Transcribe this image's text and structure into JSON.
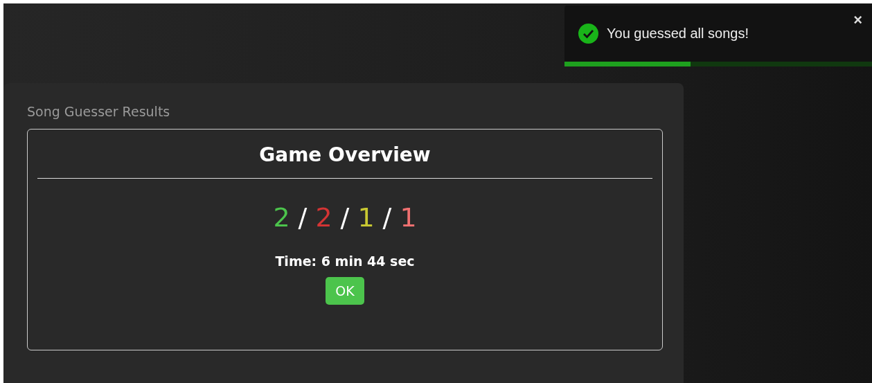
{
  "toast": {
    "message": "You guessed all songs!",
    "close": "×",
    "level": 0.41
  },
  "panel": {
    "title": "Song Guesser Results"
  },
  "overview": {
    "heading": "Game Overview",
    "scores": [
      {
        "value": "2",
        "color": "#4cc44c"
      },
      {
        "value": "2",
        "color": "#d33434"
      },
      {
        "value": "1",
        "color": "#c8c832"
      },
      {
        "value": "1",
        "color": "#f07070"
      }
    ],
    "separator": "/",
    "time": "Time: 6 min 44 sec",
    "button": "OK"
  }
}
